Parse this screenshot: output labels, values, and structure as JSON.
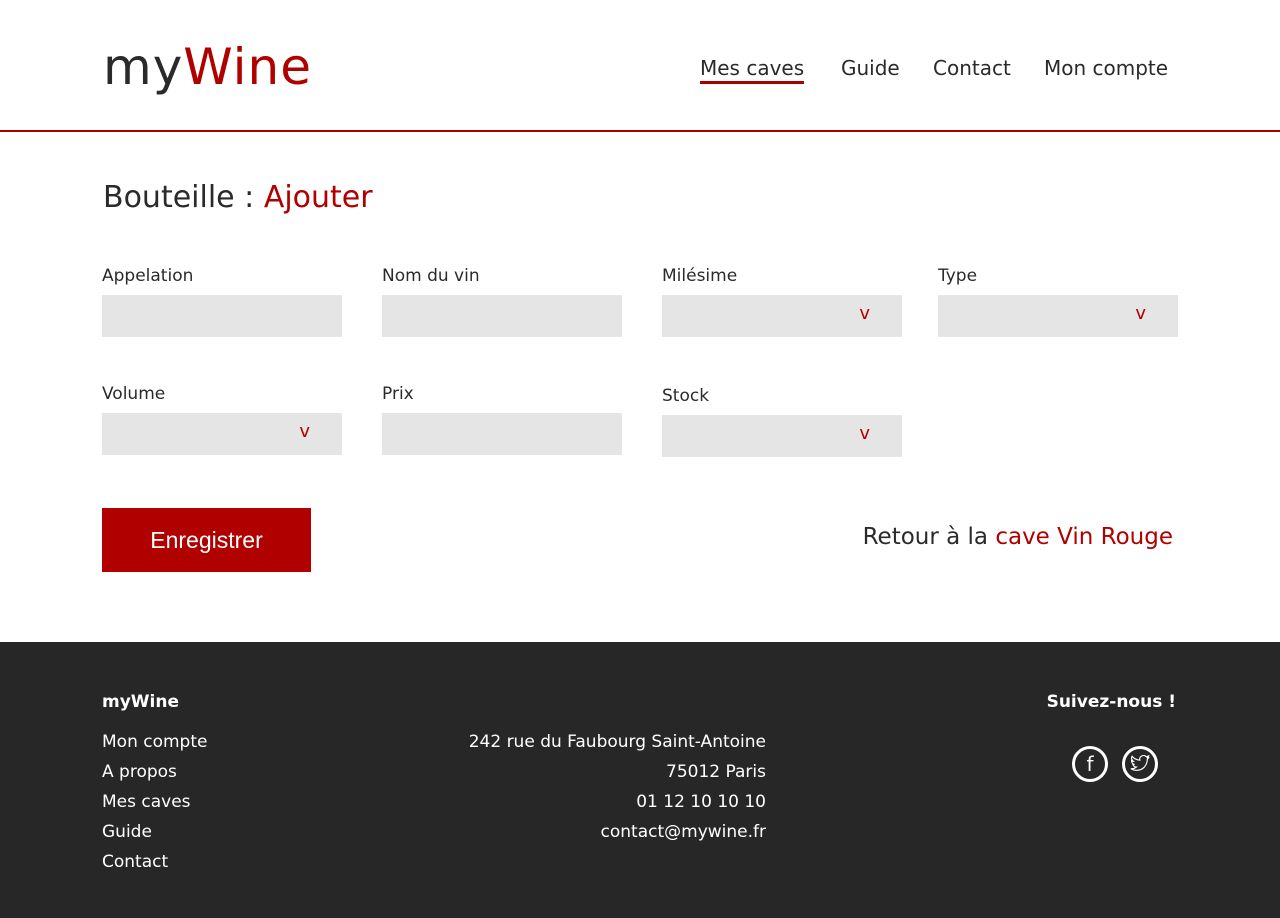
{
  "header": {
    "logo_my": "my",
    "logo_wine": "Wine",
    "nav": [
      "Mes caves",
      "Guide",
      "Contact",
      "Mon compte"
    ]
  },
  "page": {
    "title_prefix": "Bouteille : ",
    "title_action": "Ajouter"
  },
  "form": {
    "fields": [
      "Appelation",
      "Nom du vin",
      "Milésime",
      "Type",
      "Volume",
      "Prix",
      "Stock"
    ],
    "submit": "Enregistrer",
    "back_prefix": "Retour à la ",
    "back_link": "cave Vin Rouge"
  },
  "footer": {
    "brand": "myWine",
    "links": [
      "Mon compte",
      "A propos",
      "Mes caves",
      "Guide",
      "Contact"
    ],
    "address": [
      "242 rue du Faubourg Saint-Antoine",
      "75012 Paris",
      "01 12 10 10 10",
      "contact@mywine.fr"
    ],
    "follow": "Suivez-nous !",
    "icons": [
      "facebook-icon",
      "twitter-icon"
    ]
  },
  "colors": {
    "accent": "#b00000",
    "footer_bg": "#272727"
  }
}
